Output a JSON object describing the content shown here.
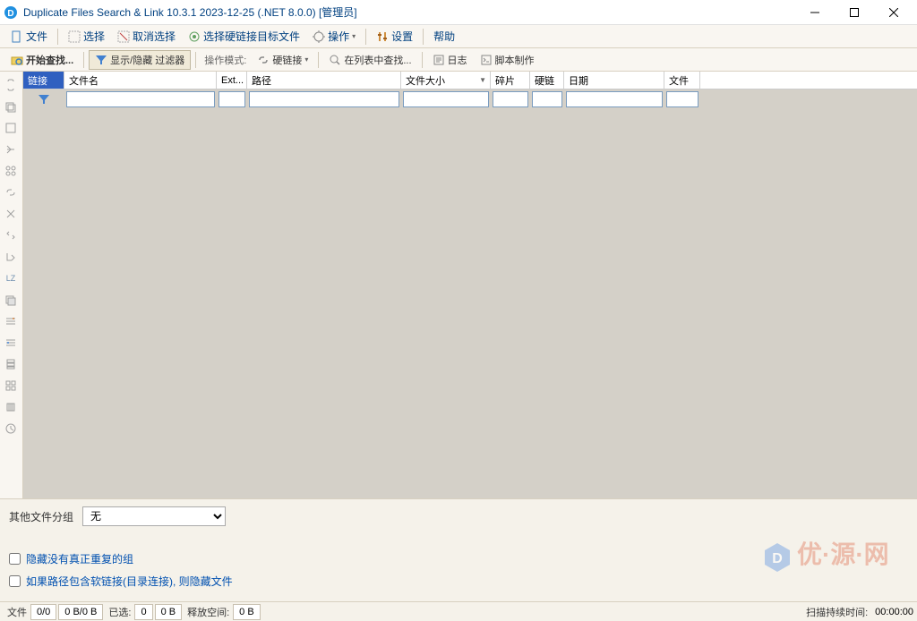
{
  "title": "Duplicate Files Search & Link 10.3.1 2023-12-25 (.NET 8.0.0) [管理员]",
  "menubar": {
    "file": "文件",
    "select": "选择",
    "deselect": "取消选择",
    "select_hardlink_target": "选择硬链接目标文件",
    "operate": "操作",
    "settings": "设置",
    "help": "帮助"
  },
  "toolbar": {
    "start_search": "开始查找...",
    "show_hide_filter": "显示/隐藏 过滤器",
    "operate_mode": "操作模式:",
    "hardlink": "硬链接",
    "search_in_list": "在列表中查找...",
    "log": "日志",
    "script": "脚本制作"
  },
  "columns": {
    "link": "链接",
    "name": "文件名",
    "ext": "Ext...",
    "path": "路径",
    "size": "文件大小",
    "frag": "碎片",
    "hard": "硬链",
    "date": "日期",
    "files": "文件"
  },
  "bottom": {
    "group_label": "其他文件分组",
    "group_value": "无",
    "hide_no_dup": "隐藏没有真正重复的组",
    "hide_softlink": "如果路径包含软链接(目录连接), 则隐藏文件"
  },
  "status": {
    "files_label": "文件",
    "files_count": "0/0",
    "bytes": "0 B/0 B",
    "selected_label": "已选:",
    "selected": "0",
    "zero_b": "0 B",
    "free_label": "释放空间:",
    "free": "0 B",
    "scan_label": "扫描持续时间:",
    "scan_time": "00:00:00"
  }
}
